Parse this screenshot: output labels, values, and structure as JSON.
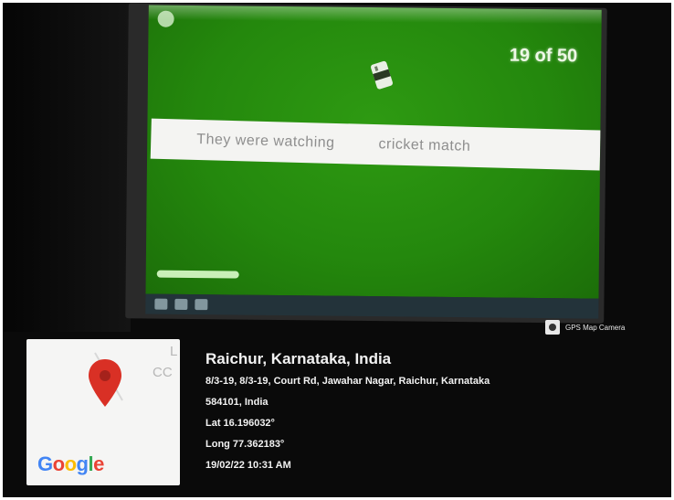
{
  "quiz": {
    "counter": "19 of 50",
    "sentence_part_1": "They were watching",
    "sentence_part_2": "cricket match",
    "progress": 0.18
  },
  "overlay": {
    "badge_label": "GPS Map Camera",
    "map_brand": "Google",
    "map_fragment_1": "L",
    "map_fragment_2": "CC",
    "location_title": "Raichur, Karnataka, India",
    "address_line_1": "8/3-19, 8/3-19, Court Rd, Jawahar Nagar, Raichur, Karnataka",
    "address_line_2": "584101, India",
    "latitude": "Lat 16.196032°",
    "longitude": "Long 77.362183°",
    "datetime": "19/02/22 10:31 AM"
  },
  "colors": {
    "screen_green": "#2e9a12",
    "pin_red": "#d93025",
    "overlay_bg": "#0a0a0a"
  },
  "icons": [
    "gps-camera-icon",
    "map-pin-icon",
    "cricket-ball-icon"
  ]
}
